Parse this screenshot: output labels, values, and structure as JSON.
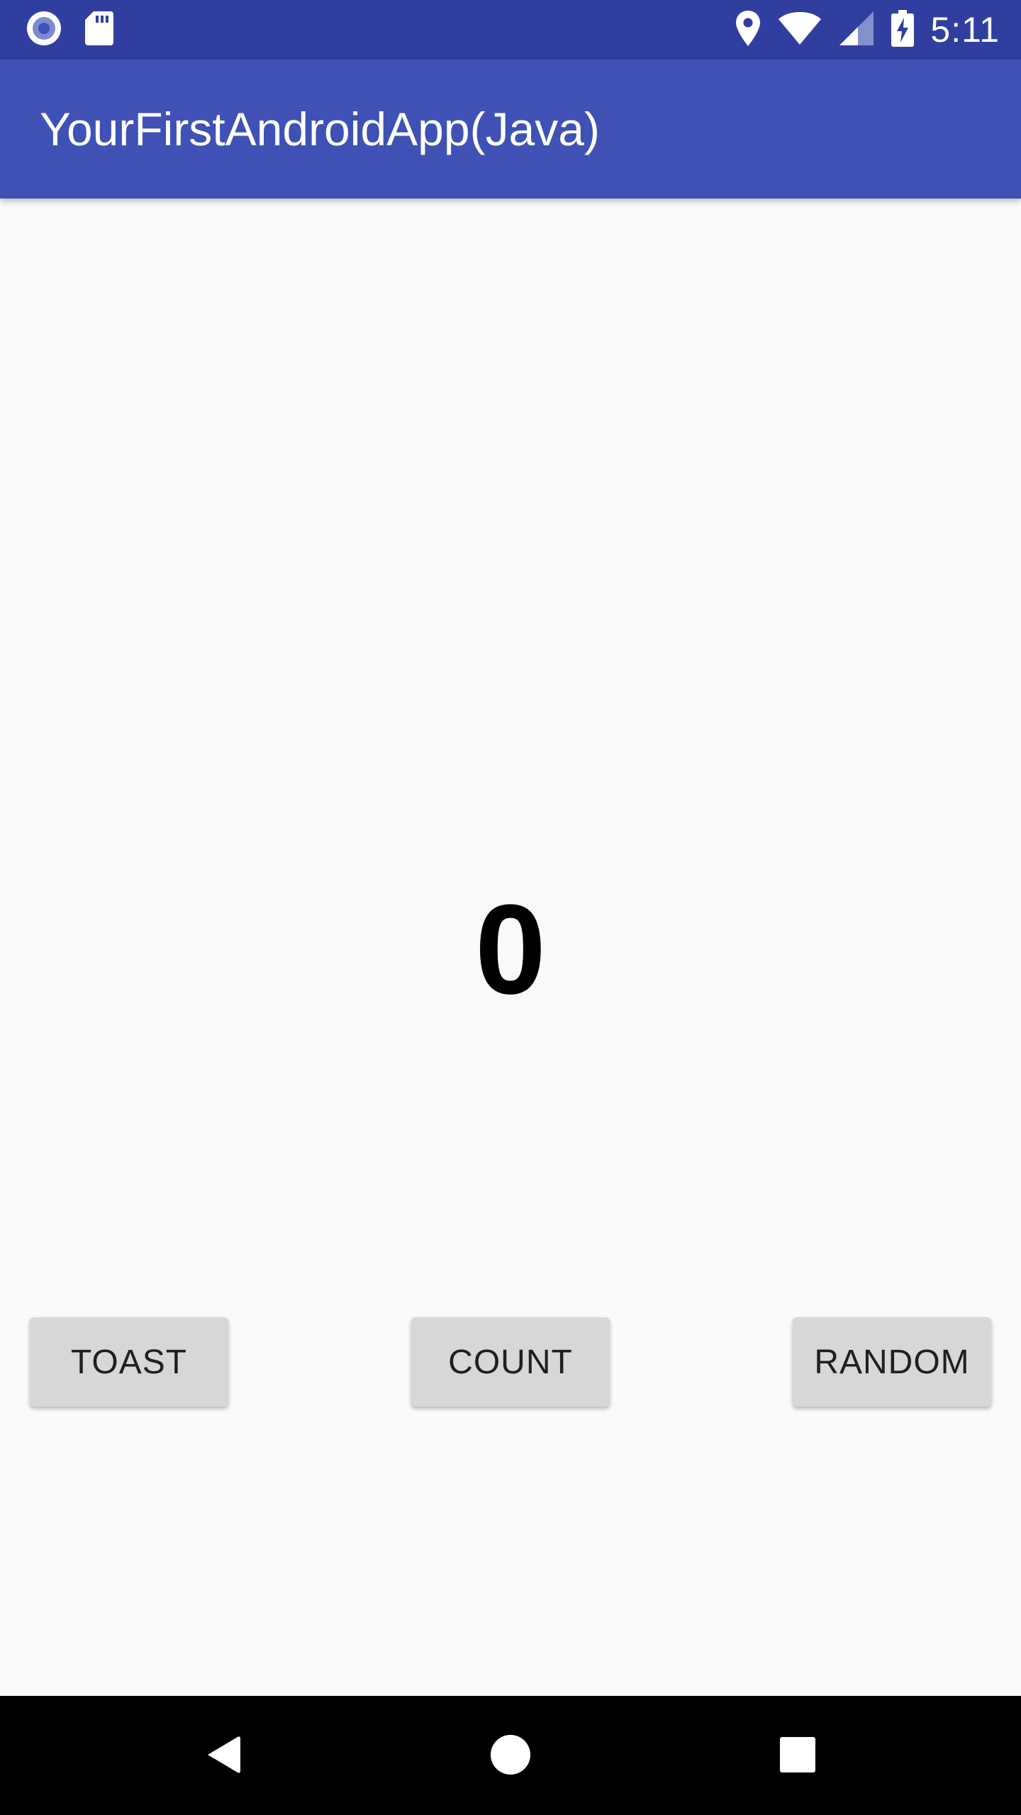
{
  "status_bar": {
    "time": "5:11",
    "left_icons": [
      "record-icon",
      "sd-card-icon"
    ],
    "right_icons": [
      "location-icon",
      "wifi-icon",
      "cell-signal-icon",
      "battery-charging-icon"
    ]
  },
  "app_bar": {
    "title": "YourFirstAndroidApp(Java)"
  },
  "main": {
    "count_value": "0",
    "buttons": {
      "toast": "TOAST",
      "count": "COUNT",
      "random": "RANDOM"
    }
  },
  "nav_bar": {
    "icons": [
      "back-icon",
      "home-icon",
      "recents-icon"
    ]
  },
  "colors": {
    "status_bar": "#303f9f",
    "app_bar": "#3f51b5",
    "background": "#fafafa",
    "button": "#d6d7d7",
    "nav_bar": "#000000"
  }
}
